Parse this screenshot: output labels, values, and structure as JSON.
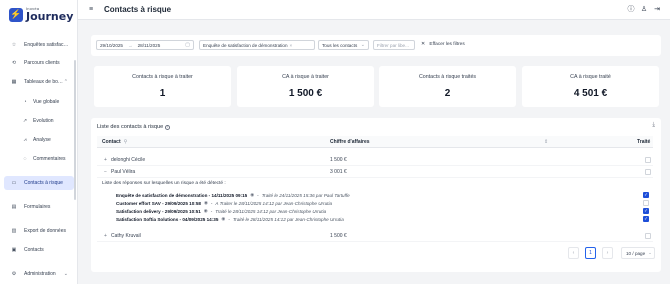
{
  "brand": {
    "small": "Inovéa",
    "name": "Journey"
  },
  "sidebar": {
    "items": [
      {
        "label": "Enquêtes satisfac…",
        "icon": "star-icon"
      },
      {
        "label": "Parcours clients",
        "icon": "route-icon"
      },
      {
        "label": "Tableaux de bo…",
        "icon": "dashboard-icon"
      },
      {
        "label": "Vue globale",
        "icon": "pie-chart-icon"
      },
      {
        "label": "Evolution",
        "icon": "trend-icon"
      },
      {
        "label": "Analyse",
        "icon": "analysis-icon"
      },
      {
        "label": "Commentaires",
        "icon": "comment-icon"
      },
      {
        "label": "Contacts à risque",
        "icon": "alert-contacts-icon"
      },
      {
        "label": "Formulaires",
        "icon": "form-icon"
      },
      {
        "label": "Export de données",
        "icon": "export-icon"
      },
      {
        "label": "Contacts",
        "icon": "contacts-icon"
      },
      {
        "label": "Administration",
        "icon": "gear-icon"
      }
    ]
  },
  "header": {
    "title": "Contacts à risque"
  },
  "filters": {
    "date_from": "29/10/2025",
    "date_to": "28/11/2025",
    "date_separator": "→",
    "survey": "Enquête de satisfaction de démonstration",
    "contacts": "Tous les contacts",
    "search_placeholder": "Filtrer par libe...",
    "clear_label": "Effacer les filtres"
  },
  "stats": [
    {
      "label": "Contacts à risque à traiter",
      "value": "1"
    },
    {
      "label": "CA à risque à traiter",
      "value": "1 500 €"
    },
    {
      "label": "Contacts à risque traités",
      "value": "2"
    },
    {
      "label": "CA à risque traité",
      "value": "4 501 €"
    }
  ],
  "table": {
    "title": "Liste des contacts à risque",
    "columns": {
      "contact": "Contact",
      "revenue": "Chiffre d'affaires",
      "treated": "Traité"
    },
    "rows": [
      {
        "expander": "+",
        "name": "delonghi Cécile",
        "amount": "1 500 €",
        "treated": false
      },
      {
        "expander": "−",
        "name": "Paul Vélira",
        "amount": "3 001 €",
        "treated": false
      },
      {
        "expander": "+",
        "name": "Cathy Kruvail",
        "amount": "1 500 €",
        "treated": false
      }
    ],
    "detail": {
      "label": "Liste des réponses sur lesquelles un risque a été détecté :",
      "responses": [
        {
          "title": "Enquête de satisfaction de démonstration - 14/11/2025 09:15",
          "status": "Traité le 24/11/2025 15:36 par Paul Tartuffe",
          "checked": true
        },
        {
          "title": "Customer effort SAV - 29/09/2025 10:58",
          "status": "A Traiter le 28/11/2025 14:12 par Jean-Christophe Urrutia",
          "checked": false
        },
        {
          "title": "Satisfaction delivery - 29/09/2025 10:51",
          "status": "Traité le 28/11/2025 14:12 par Jean-Christophe Urrutia",
          "checked": true
        },
        {
          "title": "Satisfaction Softia Solutions - 04/09/2025 14:35",
          "status": "Traité le 28/11/2025 14:12 par Jean-Christophe Urrutia",
          "checked": true
        }
      ]
    }
  },
  "pagination": {
    "prev": "‹",
    "current": "1",
    "next": "›",
    "page_size": "10 / page"
  },
  "colors": {
    "accent": "#1d4ed8",
    "brand": "#2f54c9",
    "active_nav": "#e0e7ff"
  }
}
